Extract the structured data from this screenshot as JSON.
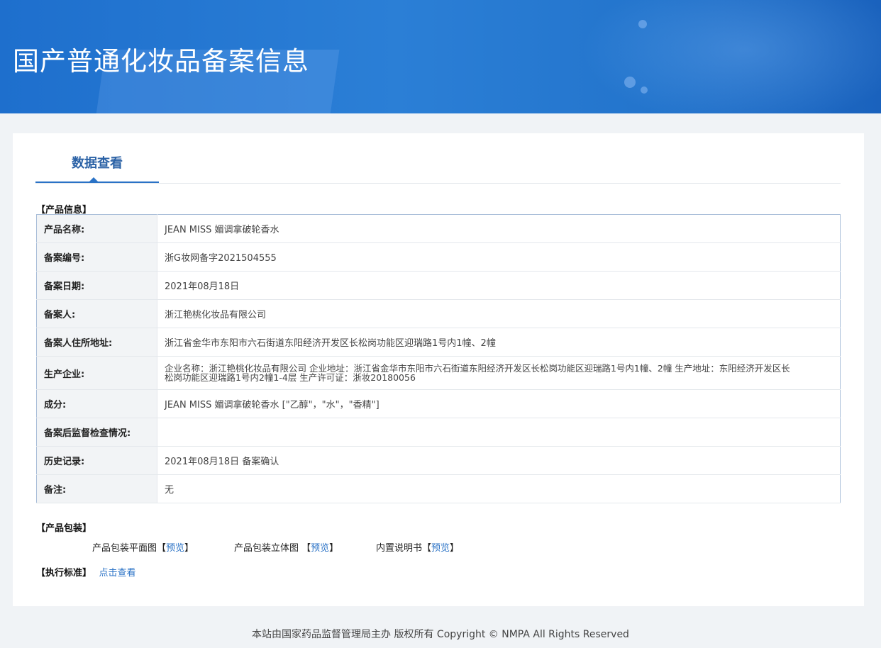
{
  "header": {
    "title": "国产普通化妆品备案信息"
  },
  "tabs": [
    {
      "label": "数据查看"
    }
  ],
  "product_info": {
    "section_title": "【产品信息】",
    "rows": [
      {
        "label": "产品名称:",
        "value": "JEAN MISS 媚调拿破轮香水"
      },
      {
        "label": "备案编号:",
        "value": "浙G妆网备字2021504555"
      },
      {
        "label": "备案日期:",
        "value": "2021年08月18日"
      },
      {
        "label": "备案人:",
        "value": "浙江艳桃化妆品有限公司"
      },
      {
        "label": "备案人住所地址:",
        "value": "浙江省金华市东阳市六石街道东阳经济开发区长松岗功能区迎瑞路1号内1幢、2幢"
      },
      {
        "label": "生产企业:",
        "value": "企业名称：浙江艳桃化妆品有限公司 企业地址：浙江省金华市东阳市六石街道东阳经济开发区长松岗功能区迎瑞路1号内1幢、2幢 生产地址：东阳经济开发区长松岗功能区迎瑞路1号内2幢1-4层 生产许可证：浙妆20180056"
      },
      {
        "label": "成分:",
        "value": "JEAN MISS 媚调拿破轮香水 [\"乙醇\"，\"水\"，\"香精\"]"
      },
      {
        "label": "备案后监督检查情况:",
        "value": ""
      },
      {
        "label": "历史记录:",
        "value": "2021年08月18日 备案确认"
      },
      {
        "label": "备注:",
        "value": "无"
      }
    ]
  },
  "packaging": {
    "section_title": "【产品包装】",
    "items": [
      {
        "label": "产品包装平面图",
        "open": "【",
        "link": "预览",
        "close": "】"
      },
      {
        "label": "产品包装立体图 ",
        "open": "【",
        "link": "预览",
        "close": "】"
      },
      {
        "label": "内置说明书",
        "open": "【",
        "link": "预览",
        "close": "】"
      }
    ]
  },
  "standard": {
    "section_title": "【执行标准】",
    "link": "点击查看"
  },
  "footer": {
    "text": "本站由国家药品监督管理局主办 版权所有 Copyright © NMPA All Rights Reserved"
  }
}
